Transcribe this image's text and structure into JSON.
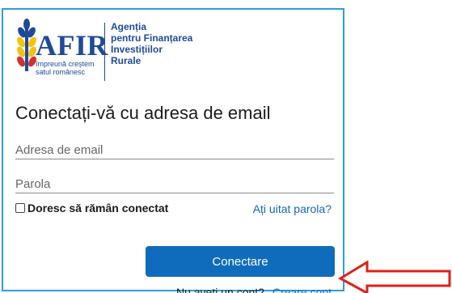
{
  "logo": {
    "name": "AFIR",
    "tagline_line1": "împreună creștem",
    "tagline_line2": "satul românesc",
    "agency_line1": "Agenția",
    "agency_line2": "pentru Finanțarea",
    "agency_line3": "Investițiilor",
    "agency_line4": "Rurale"
  },
  "login": {
    "title": "Conectați-vă cu adresa de email",
    "email_placeholder": "Adresa de email",
    "password_placeholder": "Parola",
    "remember_label": "Doresc să rămân conectat",
    "remember_checked": false,
    "forgot_link": "Ați uitat parola?",
    "submit_label": "Conectare",
    "no_account_text": "Nu aveți un cont?",
    "create_account_link": "Creare cont"
  },
  "colors": {
    "card_border": "#2f9be0",
    "brand_blue": "#1e4a9a",
    "button_bg": "#0f6cbd",
    "link": "#1565c0",
    "annotation_arrow": "#e0201b"
  },
  "icons": {
    "logo_mark": "wheat-sprout-icon",
    "annotation": "red-arrow-icon"
  }
}
